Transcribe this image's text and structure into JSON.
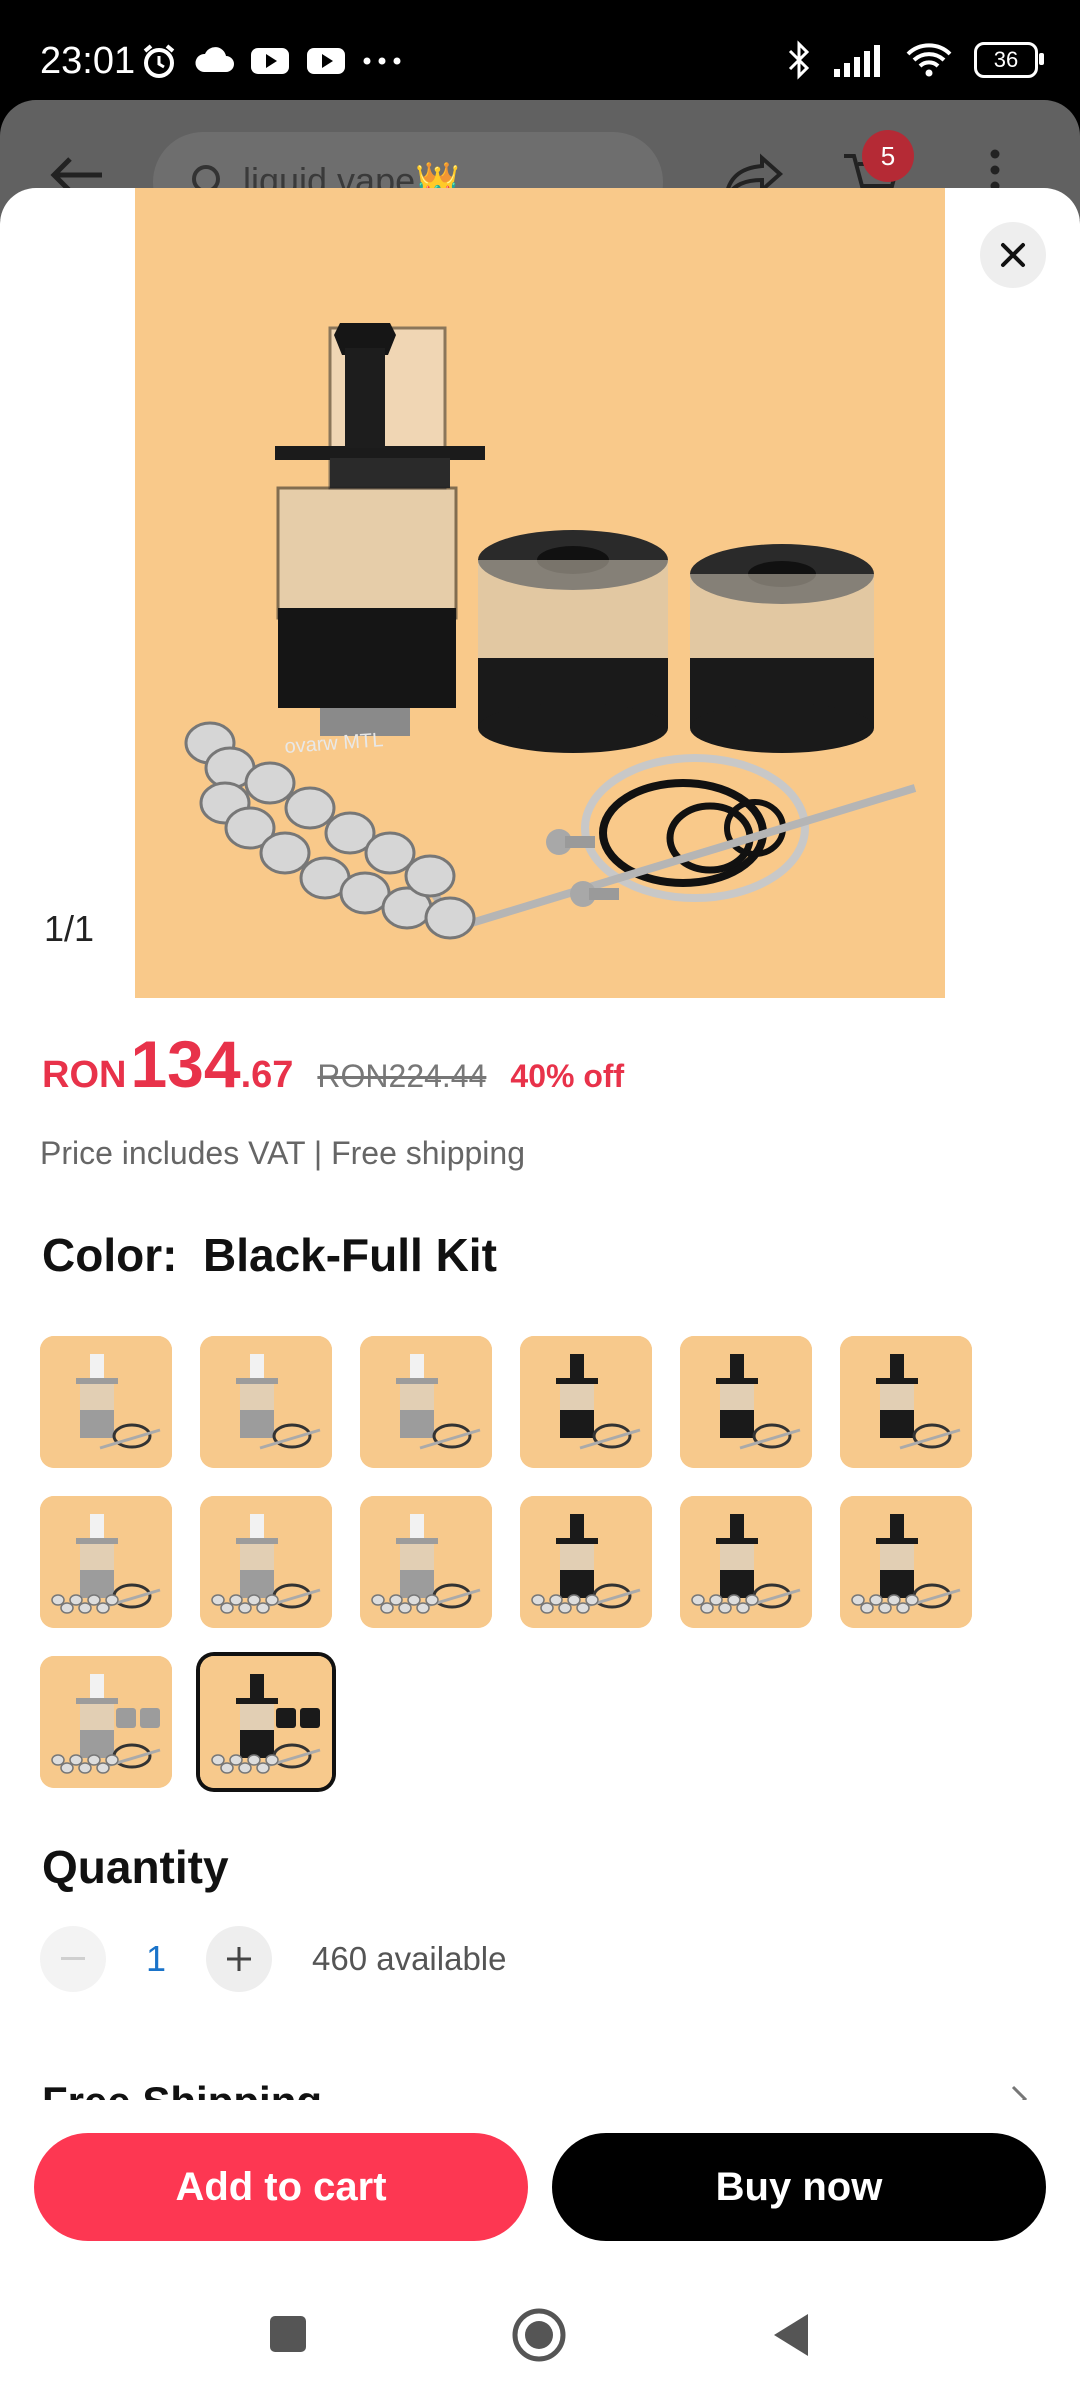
{
  "status_bar": {
    "time": "23:01",
    "battery": "36"
  },
  "background_app": {
    "search_text": "liquid vape👑",
    "cart_badge": "5"
  },
  "product": {
    "image_counter": "1/1",
    "brand_text": "ovarw MTL"
  },
  "price": {
    "currency": "RON",
    "integer": "134",
    "decimal": ".67",
    "original": "RON224.44",
    "discount": "40% off",
    "note": "Price includes VAT | Free shipping"
  },
  "color": {
    "label": "Color:",
    "selected": "Black-Full Kit"
  },
  "variants": [
    {
      "style": "silver-tank"
    },
    {
      "style": "silver-tank"
    },
    {
      "style": "silver-tank"
    },
    {
      "style": "black-tank"
    },
    {
      "style": "black-tank"
    },
    {
      "style": "black-tank"
    },
    {
      "style": "silver-kit"
    },
    {
      "style": "silver-kit"
    },
    {
      "style": "silver-kit"
    },
    {
      "style": "black-kit"
    },
    {
      "style": "black-kit"
    },
    {
      "style": "black-kit"
    },
    {
      "style": "silver-full"
    },
    {
      "style": "black-full",
      "selected": true
    }
  ],
  "quantity": {
    "title": "Quantity",
    "value": "1",
    "available": "460 available"
  },
  "shipping_peek": "Free Shipping",
  "actions": {
    "add_to_cart": "Add to cart",
    "buy_now": "Buy now"
  },
  "colors": {
    "accent": "#fd3752",
    "price": "#e8324a",
    "buy": "#000000",
    "quantity_value": "#1a73c9"
  }
}
